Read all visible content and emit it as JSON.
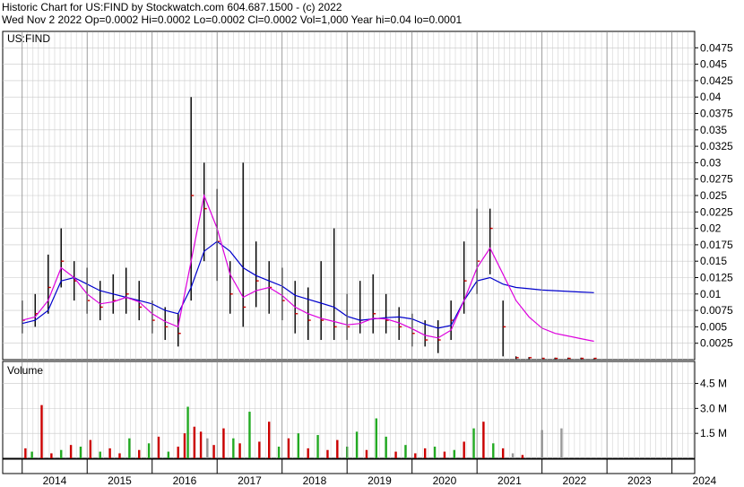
{
  "header": {
    "line1": "Historic Chart for US:FIND by Stockwatch.com 604.687.1500 - (c) 2022",
    "line2": "Wed Nov  2 2022   Op=0.0002  Hi=0.0002  Lo=0.0002  Cl=0.0002  Vol=1,000  Year hi=0.04  lo=0.0001"
  },
  "colors": {
    "price_bar": "#000000",
    "close_tick": "#cc0000",
    "ma_short": "#dd00dd",
    "ma_long": "#0000cc",
    "vol_up": "#22aa22",
    "vol_down": "#cc0000",
    "vol_neutral": "#999999",
    "grid": "#c8c8c8"
  },
  "chart_data": [
    {
      "type": "line",
      "title": "US:FIND",
      "ylim": [
        0,
        0.05
      ],
      "yticks": [
        "0.0025",
        "0.005",
        "0.0075",
        "0.01",
        "0.0125",
        "0.015",
        "0.0175",
        "0.02",
        "0.0225",
        "0.025",
        "0.0275",
        "0.03",
        "0.0325",
        "0.035",
        "0.0375",
        "0.04",
        "0.0425",
        "0.045",
        "0.0475"
      ],
      "x": [
        2014.0,
        2014.2,
        2014.4,
        2014.6,
        2014.8,
        2015.0,
        2015.2,
        2015.4,
        2015.6,
        2015.8,
        2016.0,
        2016.2,
        2016.4,
        2016.6,
        2016.8,
        2017.0,
        2017.2,
        2017.4,
        2017.6,
        2017.8,
        2018.0,
        2018.2,
        2018.4,
        2018.6,
        2018.8,
        2019.0,
        2019.2,
        2019.4,
        2019.6,
        2019.8,
        2020.0,
        2020.2,
        2020.4,
        2020.6,
        2020.8,
        2021.0,
        2021.2,
        2021.4,
        2021.6,
        2021.8,
        2022.0,
        2022.2,
        2022.4,
        2022.6,
        2022.8
      ],
      "series": [
        {
          "role": "price_close",
          "values": [
            0.006,
            0.007,
            0.011,
            0.015,
            0.012,
            0.009,
            0.008,
            0.009,
            0.01,
            0.008,
            0.006,
            0.005,
            0.004,
            0.025,
            0.023,
            0.018,
            0.01,
            0.008,
            0.012,
            0.011,
            0.009,
            0.007,
            0.006,
            0.006,
            0.005,
            0.005,
            0.006,
            0.007,
            0.006,
            0.005,
            0.004,
            0.003,
            0.003,
            0.006,
            0.012,
            0.015,
            0.02,
            0.005,
            0.0003,
            0.0003,
            0.0002,
            0.0002,
            0.0002,
            0.0002,
            0.0002
          ]
        },
        {
          "role": "price_high",
          "values": [
            0.009,
            0.01,
            0.016,
            0.02,
            0.015,
            0.014,
            0.012,
            0.013,
            0.014,
            0.012,
            0.009,
            0.008,
            0.007,
            0.04,
            0.03,
            0.026,
            0.015,
            0.03,
            0.018,
            0.015,
            0.014,
            0.012,
            0.011,
            0.015,
            0.02,
            0.01,
            0.012,
            0.013,
            0.01,
            0.008,
            0.007,
            0.006,
            0.006,
            0.009,
            0.018,
            0.023,
            0.023,
            0.009,
            0.0005,
            0.0004,
            0.0003,
            0.0003,
            0.0003,
            0.0003,
            0.0002
          ]
        },
        {
          "role": "price_low",
          "values": [
            0.004,
            0.005,
            0.007,
            0.011,
            0.009,
            0.007,
            0.006,
            0.007,
            0.007,
            0.006,
            0.004,
            0.003,
            0.002,
            0.009,
            0.015,
            0.012,
            0.007,
            0.005,
            0.008,
            0.007,
            0.006,
            0.004,
            0.003,
            0.003,
            0.003,
            0.003,
            0.004,
            0.004,
            0.004,
            0.003,
            0.002,
            0.002,
            0.001,
            0.003,
            0.007,
            0.01,
            0.013,
            0.0005,
            0.0001,
            0.0001,
            0.0001,
            0.0001,
            0.0001,
            0.0001,
            0.0001
          ]
        },
        {
          "role": "ma_short",
          "values": [
            0.006,
            0.0065,
            0.009,
            0.014,
            0.0125,
            0.01,
            0.0085,
            0.0088,
            0.0095,
            0.0088,
            0.007,
            0.0058,
            0.005,
            0.015,
            0.025,
            0.02,
            0.013,
            0.0095,
            0.0105,
            0.011,
            0.0098,
            0.008,
            0.007,
            0.0063,
            0.0058,
            0.0053,
            0.0055,
            0.0063,
            0.0062,
            0.0056,
            0.0047,
            0.0037,
            0.0033,
            0.0045,
            0.009,
            0.014,
            0.017,
            0.013,
            0.009,
            0.0065,
            0.0048,
            0.004,
            0.0036,
            0.0032,
            0.0028
          ]
        },
        {
          "role": "ma_long",
          "values": [
            0.0055,
            0.006,
            0.0075,
            0.012,
            0.0125,
            0.0115,
            0.0105,
            0.01,
            0.0095,
            0.009,
            0.0085,
            0.0075,
            0.007,
            0.011,
            0.0165,
            0.018,
            0.0165,
            0.014,
            0.0128,
            0.012,
            0.0112,
            0.0098,
            0.0092,
            0.0086,
            0.008,
            0.0066,
            0.006,
            0.0062,
            0.0064,
            0.0065,
            0.0062,
            0.0054,
            0.0048,
            0.0052,
            0.009,
            0.012,
            0.0125,
            0.0115,
            0.011,
            0.0108,
            0.0106,
            0.0105,
            0.0104,
            0.0103,
            0.0102
          ]
        }
      ]
    },
    {
      "type": "bar",
      "title": "Volume",
      "ylim": [
        0,
        5500000
      ],
      "yticks": [
        "1.5 M",
        "3.0 M",
        "4.5 M"
      ],
      "ytick_values": [
        1500000,
        3000000,
        4500000
      ],
      "x": [
        2014.05,
        2014.15,
        2014.3,
        2014.45,
        2014.6,
        2014.75,
        2014.9,
        2015.05,
        2015.2,
        2015.35,
        2015.5,
        2015.65,
        2015.8,
        2015.95,
        2016.1,
        2016.25,
        2016.4,
        2016.5,
        2016.55,
        2016.65,
        2016.75,
        2016.85,
        2016.95,
        2017.1,
        2017.25,
        2017.35,
        2017.5,
        2017.65,
        2017.8,
        2017.95,
        2018.1,
        2018.25,
        2018.4,
        2018.55,
        2018.7,
        2018.85,
        2019.0,
        2019.15,
        2019.3,
        2019.45,
        2019.6,
        2019.75,
        2019.9,
        2020.05,
        2020.2,
        2020.35,
        2020.5,
        2020.65,
        2020.8,
        2020.95,
        2021.1,
        2021.25,
        2021.4,
        2021.55,
        2021.7,
        2022.0,
        2022.3
      ],
      "values": [
        600000,
        400000,
        3200000,
        300000,
        500000,
        800000,
        700000,
        1100000,
        400000,
        600000,
        300000,
        1200000,
        500000,
        900000,
        1300000,
        400000,
        700000,
        1500000,
        3100000,
        1900000,
        1600000,
        1200000,
        800000,
        1800000,
        1200000,
        900000,
        2800000,
        1000000,
        2200000,
        700000,
        1200000,
        1500000,
        600000,
        1400000,
        500000,
        1100000,
        700000,
        1600000,
        500000,
        2400000,
        1300000,
        400000,
        800000,
        300000,
        600000,
        700000,
        400000,
        500000,
        1000000,
        1800000,
        2200000,
        900000,
        600000,
        300000,
        200000,
        1700000,
        1800000
      ],
      "dir": [
        "down",
        "up",
        "down",
        "down",
        "up",
        "down",
        "up",
        "down",
        "up",
        "down",
        "down",
        "up",
        "down",
        "up",
        "down",
        "up",
        "down",
        "down",
        "up",
        "down",
        "down",
        "neutral",
        "down",
        "down",
        "up",
        "down",
        "up",
        "down",
        "down",
        "up",
        "down",
        "up",
        "down",
        "up",
        "down",
        "down",
        "up",
        "up",
        "down",
        "up",
        "up",
        "down",
        "up",
        "down",
        "down",
        "up",
        "down",
        "up",
        "down",
        "up",
        "down",
        "up",
        "down",
        "neutral",
        "down",
        "neutral",
        "neutral"
      ]
    }
  ],
  "x_axis": {
    "labels": [
      "2014",
      "2015",
      "2016",
      "2017",
      "2018",
      "2019",
      "2020",
      "2021",
      "2022",
      "2023",
      "2024"
    ],
    "years": [
      2014,
      2015,
      2016,
      2017,
      2018,
      2019,
      2020,
      2021,
      2022,
      2023,
      2024
    ]
  }
}
